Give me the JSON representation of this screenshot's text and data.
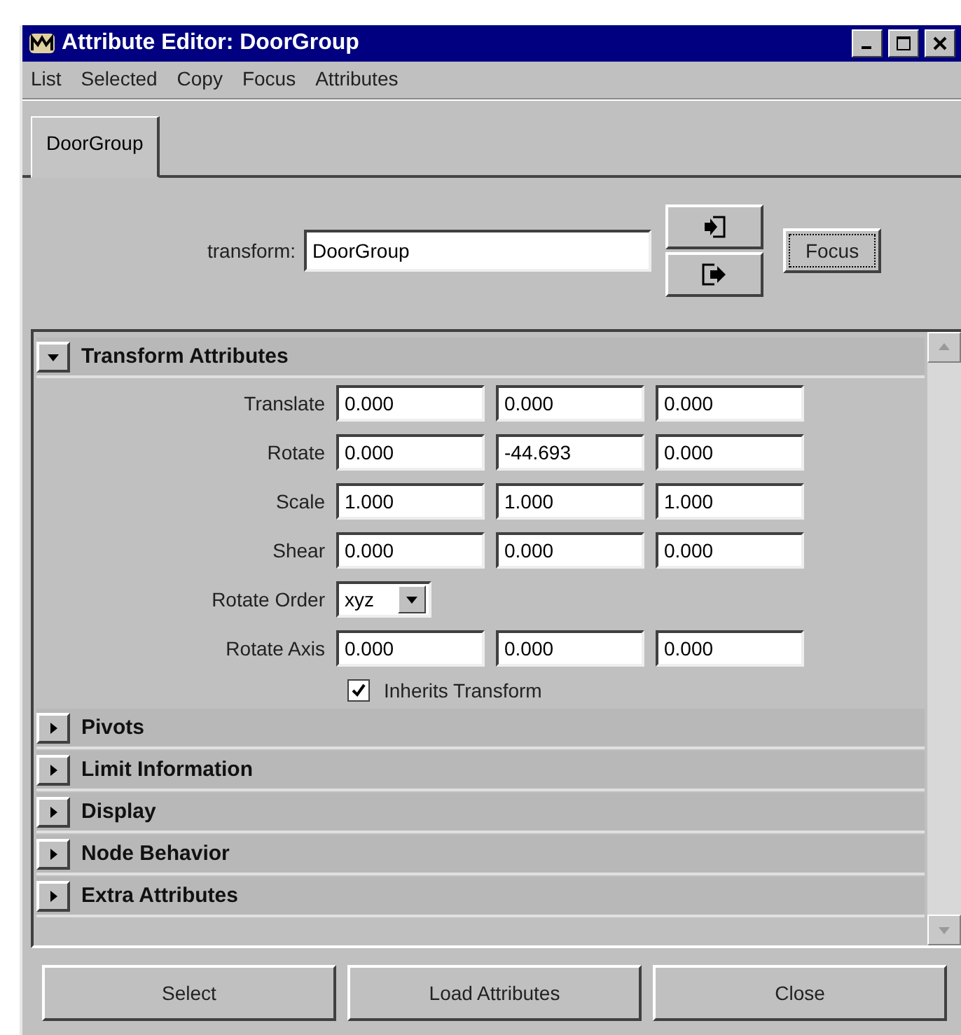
{
  "window": {
    "title": "Attribute Editor: DoorGroup"
  },
  "menu": [
    "List",
    "Selected",
    "Copy",
    "Focus",
    "Attributes"
  ],
  "tabs": [
    {
      "label": "DoorGroup",
      "selected": true
    }
  ],
  "node": {
    "label": "transform:",
    "value": "DoorGroup"
  },
  "focus_button": "Focus",
  "sections": [
    {
      "title": "Transform Attributes",
      "expanded": true,
      "rows": [
        {
          "kind": "vector",
          "label": "Translate",
          "values": [
            "0.000",
            "0.000",
            "0.000"
          ]
        },
        {
          "kind": "vector",
          "label": "Rotate",
          "values": [
            "0.000",
            "-44.693",
            "0.000"
          ]
        },
        {
          "kind": "vector",
          "label": "Scale",
          "values": [
            "1.000",
            "1.000",
            "1.000"
          ]
        },
        {
          "kind": "vector",
          "label": "Shear",
          "values": [
            "0.000",
            "0.000",
            "0.000"
          ]
        },
        {
          "kind": "dropdown",
          "label": "Rotate Order",
          "value": "xyz"
        },
        {
          "kind": "vector",
          "label": "Rotate Axis",
          "values": [
            "0.000",
            "0.000",
            "0.000"
          ]
        },
        {
          "kind": "checkbox",
          "label": "Inherits Transform",
          "checked": true
        }
      ]
    },
    {
      "title": "Pivots",
      "expanded": false
    },
    {
      "title": "Limit Information",
      "expanded": false
    },
    {
      "title": "Display",
      "expanded": false
    },
    {
      "title": "Node Behavior",
      "expanded": false
    },
    {
      "title": "Extra Attributes",
      "expanded": false
    }
  ],
  "buttons": [
    "Select",
    "Load Attributes",
    "Close"
  ]
}
